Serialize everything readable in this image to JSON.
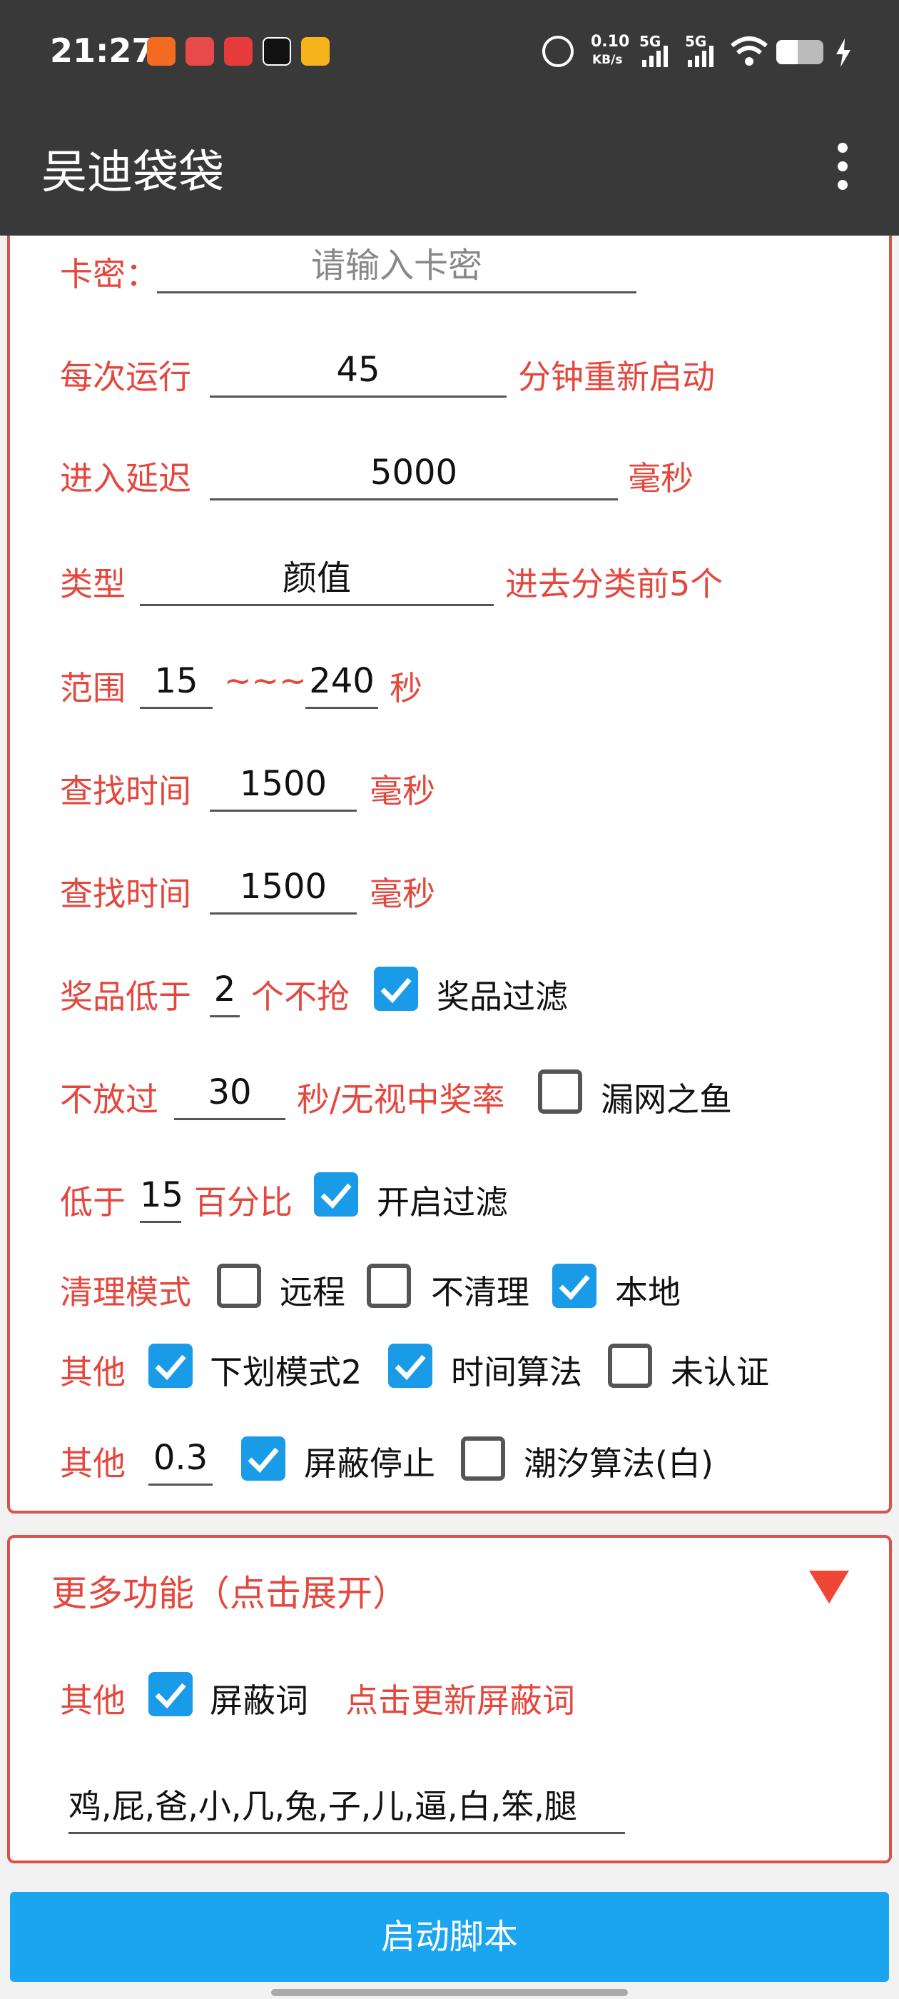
{
  "status_bar": {
    "time": "21:27",
    "net_speed_value": "0.10",
    "net_speed_unit": "KB/s",
    "signal1": "5G",
    "signal2": "5G",
    "icons": [
      "shop-app-icon",
      "game-app-icon",
      "toutiao-app-icon",
      "tiktok-app-icon",
      "weibo-app-icon",
      "alarm-icon",
      "signal-icon",
      "wifi-icon",
      "battery-icon",
      "charging-icon"
    ]
  },
  "app_bar": {
    "title": "吴迪袋袋",
    "menu_icon": "more-vert-icon"
  },
  "form": {
    "card_key_label": "卡密：",
    "card_key_placeholder": "请输入卡密",
    "run_label": "每次运行",
    "run_value": "45",
    "run_suffix": "分钟重新启动",
    "delay_label": "进入延迟",
    "delay_value": "5000",
    "delay_suffix": "毫秒",
    "type_label": "类型",
    "type_value": "颜值",
    "type_suffix": "进去分类前5个",
    "range_label": "范围",
    "range_min": "15",
    "range_sep": "~~~",
    "range_max": "240",
    "range_suffix": "秒",
    "find1_label": "查找时间",
    "find1_value": "1500",
    "find1_suffix": "毫秒",
    "find2_label": "查找时间",
    "find2_value": "1500",
    "find2_suffix": "毫秒",
    "prize_label": "奖品低于",
    "prize_value": "2",
    "prize_suffix": "个不抢",
    "prize_filter_label": "奖品过滤",
    "prize_filter_checked": true,
    "skip_label": "不放过",
    "skip_value": "30",
    "skip_suffix": "秒/无视中奖率",
    "fish_label": "漏网之鱼",
    "fish_checked": false,
    "below_label": "低于",
    "below_value": "15",
    "below_suffix": "百分比",
    "filter_label": "开启过滤",
    "filter_checked": true,
    "clean_label": "清理模式",
    "remote_label": "远程",
    "remote_checked": false,
    "noclean_label": "不清理",
    "noclean_checked": false,
    "local_label": "本地",
    "local_checked": true,
    "other1_label": "其他",
    "scroll_mode_label": "下划模式2",
    "scroll_mode_checked": true,
    "time_algo_label": "时间算法",
    "time_algo_checked": true,
    "unverified_label": "未认证",
    "unverified_checked": false,
    "other2_label": "其他",
    "other2_value": "0.3",
    "block_stop_label": "屏蔽停止",
    "block_stop_checked": true,
    "tide_label": "潮汐算法(白)",
    "tide_checked": false
  },
  "more": {
    "title": "更多功能（点击展开）",
    "expand_icon": "triangle-down-icon",
    "other_label": "其他",
    "block_words_label": "屏蔽词",
    "block_words_checked": true,
    "update_link": "点击更新屏蔽词",
    "block_words_value": "鸡,屁,爸,小,几,兔,子,儿,逼,白,笨,腿"
  },
  "start_button": "启动脚本",
  "colors": {
    "accent_red": "#e4473d",
    "checkbox_blue": "#1a9be8",
    "button_blue": "#1ba5f0",
    "appbar": "#393939"
  }
}
